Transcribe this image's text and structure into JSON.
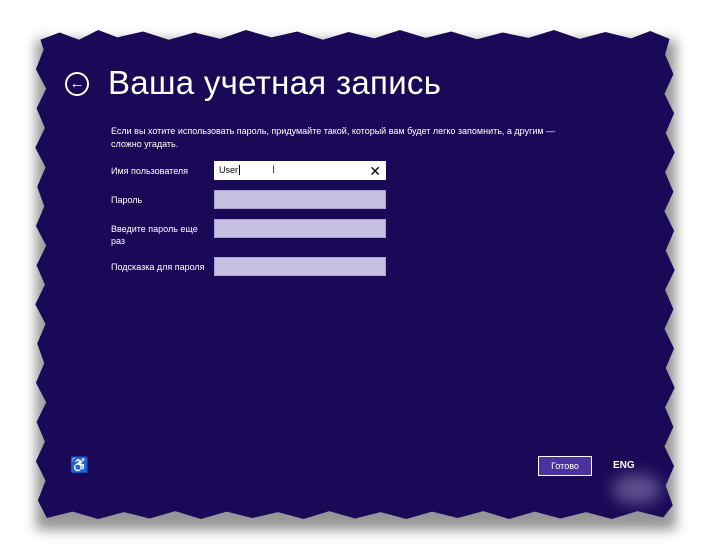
{
  "header": {
    "back_icon": "back-arrow-icon",
    "title": "Ваша учетная запись"
  },
  "form": {
    "description": "Если вы хотите использовать пароль, придумайте такой, который вам будет легко запомнить, а другим — сложно угадать.",
    "username_label": "Имя пользователя",
    "username_value": "User",
    "clear_icon": "✕",
    "password_label": "Пароль",
    "password_value": "",
    "confirm_label": "Введите пароль еще раз",
    "confirm_value": "",
    "hint_label": "Подсказка для пароля",
    "hint_value": ""
  },
  "footer": {
    "ease_icon": "ease-of-access-icon",
    "done_label": "Готово",
    "language": "ENG"
  },
  "colors": {
    "background": "#190956",
    "accent_button": "#4a33a0",
    "field_inactive": "#c8c0e0"
  }
}
